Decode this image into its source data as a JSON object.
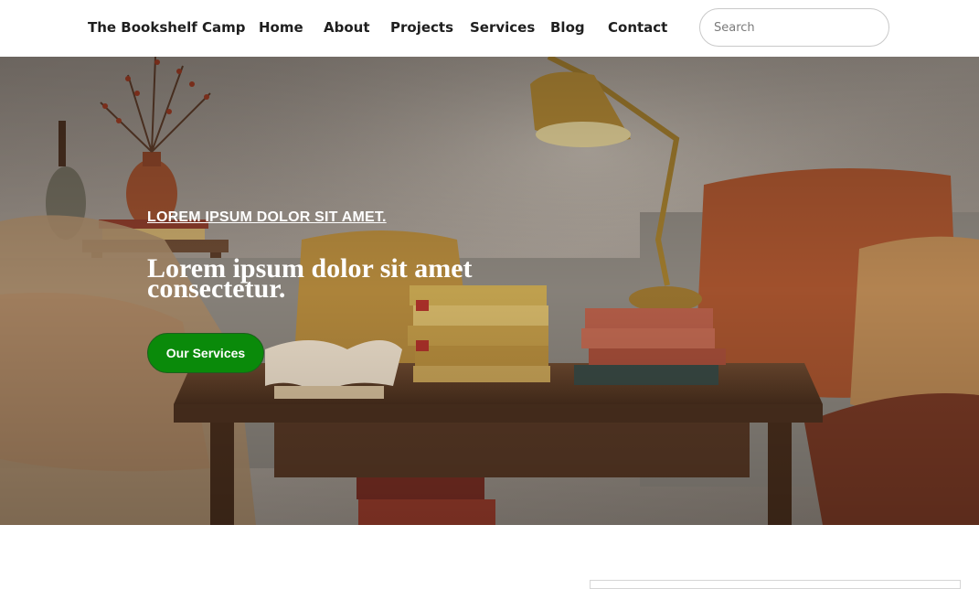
{
  "header": {
    "brand": "The Bookshelf Camp",
    "nav": {
      "home": "Home",
      "about": "About",
      "projects": "Projects",
      "services": "Services",
      "blog": "Blog",
      "contact": "Contact"
    },
    "search": {
      "placeholder": "Search",
      "value": ""
    }
  },
  "hero": {
    "eyebrow": "LOREM IPSUM DOLOR SIT AMET.",
    "headline": "Lorem ipsum dolor sit amet consectetur.",
    "cta_label": "Our Services",
    "image_subject": "cozy living room with lamp, stacked books, pillows and wooden coffee table"
  },
  "colors": {
    "cta_bg": "#0a8a0a",
    "text_dark": "#1f1f1f",
    "hero_text": "#ffffff"
  }
}
